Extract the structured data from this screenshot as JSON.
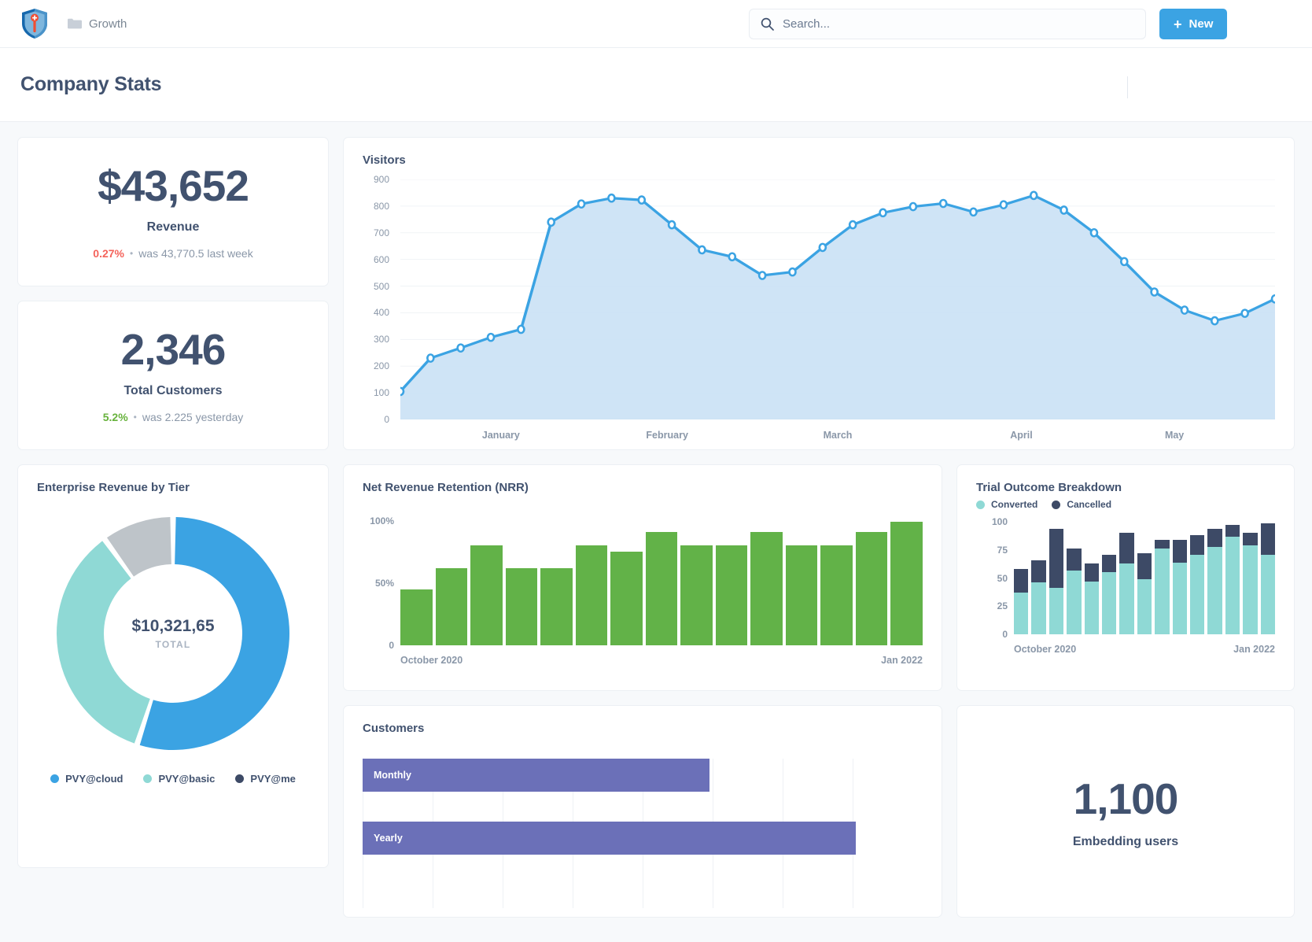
{
  "topbar": {
    "logo_icon": "shield-logo-icon",
    "folder_icon": "folder-icon",
    "breadcrumb": "Growth",
    "search": {
      "icon": "search-icon",
      "value": "",
      "placeholder": "Search..."
    },
    "new_button": {
      "label": "New",
      "icon": "plus-icon"
    }
  },
  "page": {
    "title": "Company Stats"
  },
  "stats": [
    {
      "value": "$43,652",
      "label": "Revenue",
      "delta": "0.27%",
      "delta_direction": "down",
      "delta_color": "#f4635b",
      "comparison": "was 43,770.5 last week"
    },
    {
      "value": "2,346",
      "label": "Total Customers",
      "delta": "5.2%",
      "delta_direction": "up",
      "delta_color": "#67b23c",
      "comparison": "was 2.225 yesterday"
    }
  ],
  "embedding": {
    "value": "1,100",
    "label": "Embedding users"
  },
  "cards": {
    "visitors_title": "Visitors",
    "tier_title": "Enterprise Revenue by Tier",
    "nrr_title": "Net Revenue Retention (NRR)",
    "trial_title": "Trial Outcome Breakdown",
    "customers_title": "Customers"
  },
  "donut": {
    "total_value": "$10,321,65",
    "total_label": "TOTAL",
    "legend": [
      {
        "label": "PVY@cloud",
        "color": "#3ba3e3"
      },
      {
        "label": "PVY@basic",
        "color": "#8fd9d5"
      },
      {
        "label": "PVY@me",
        "color": "#3d4a66"
      }
    ]
  },
  "chart_data": [
    {
      "type": "area",
      "title": "Visitors",
      "xlabel": "",
      "ylabel": "",
      "ylim": [
        0,
        900
      ],
      "yticks": [
        0,
        100,
        200,
        300,
        400,
        500,
        600,
        700,
        800,
        900
      ],
      "grid": true,
      "legend": "none",
      "tick_labels": [
        "January",
        "February",
        "March",
        "April",
        "May"
      ],
      "tick_positions": [
        0.115,
        0.305,
        0.5,
        0.71,
        0.885
      ],
      "line_color": "#3ba3e3",
      "fill_color": "#cbe2f5",
      "values": [
        105,
        230,
        268,
        308,
        338,
        740,
        808,
        830,
        823,
        730,
        636,
        610,
        540,
        553,
        645,
        730,
        775,
        798,
        810,
        778,
        805,
        840,
        785,
        700,
        592,
        478,
        410,
        370,
        398,
        452
      ]
    },
    {
      "type": "pie",
      "title": "Enterprise Revenue by Tier",
      "labels": [
        "PVY@cloud",
        "PVY@basic",
        "PVY@me"
      ],
      "values": [
        55,
        35,
        10
      ],
      "colors": [
        "#3ba3e3",
        "#8fd9d5",
        "#bec4c9"
      ],
      "center_text": "$10,321,65",
      "center_sub": "TOTAL",
      "legend": "bottom"
    },
    {
      "type": "bar",
      "title": "Net Revenue Retention (NRR)",
      "ylim": [
        0,
        110
      ],
      "yticks": [
        0,
        50,
        100
      ],
      "ytick_labels": [
        "0",
        "50%",
        "100%"
      ],
      "grid": true,
      "bar_color": "#62b248",
      "categories": [
        "October 2020",
        "",
        "",
        "",
        "",
        "",
        "",
        "",
        "",
        "",
        "",
        "",
        "",
        "",
        "Jan 2022"
      ],
      "xtick_labels": [
        "October 2020",
        "Jan 2022"
      ],
      "values": [
        45,
        62,
        80,
        62,
        62,
        80,
        75,
        91,
        80,
        80,
        91,
        80,
        80,
        91,
        99
      ]
    },
    {
      "type": "bar",
      "title": "Trial Outcome Breakdown",
      "stacked": true,
      "ylim": [
        0,
        105
      ],
      "yticks": [
        0,
        25,
        50,
        75,
        100
      ],
      "grid": true,
      "legend": "top",
      "xtick_labels": [
        "October 2020",
        "Jan 2022"
      ],
      "series": [
        {
          "name": "Converted",
          "color": "#8fd9d5",
          "values": [
            37,
            46,
            41,
            57,
            47,
            55,
            63,
            49,
            76,
            64,
            71,
            78,
            87,
            79,
            71
          ]
        },
        {
          "name": "Cancelled",
          "color": "#3d4a66",
          "values": [
            21,
            20,
            53,
            19,
            16,
            16,
            27,
            23,
            8,
            20,
            17,
            16,
            10,
            11,
            28
          ]
        }
      ]
    },
    {
      "type": "bar",
      "orientation": "horizontal",
      "title": "Customers",
      "bar_color": "#6b70b8",
      "categories": [
        "Monthly",
        "Yearly"
      ],
      "values": [
        62,
        88
      ]
    }
  ]
}
